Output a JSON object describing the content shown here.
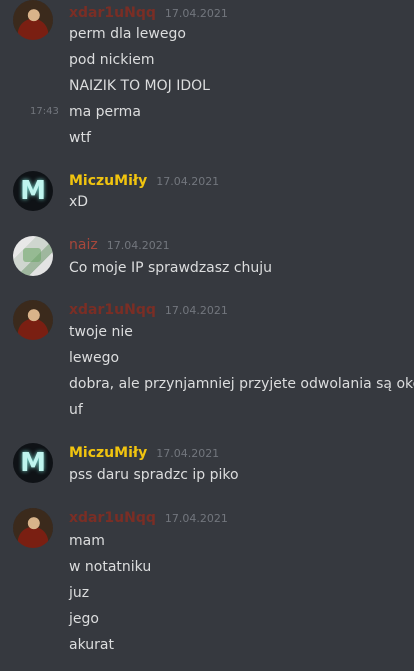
{
  "colors": {
    "user_red": "#7a2e25",
    "user_yellow": "#f1c40f",
    "user_brown": "#a8473b"
  },
  "groups": [
    {
      "username": "xdar1uNqq",
      "date": "17.04.2021",
      "lines": [
        "perm dla lewego",
        "pod nickiem",
        "NAIZIK TO MOJ IDOL",
        "ma perma",
        "wtf"
      ],
      "hover_time": "17:43"
    },
    {
      "username": "MiczuMiły",
      "date": "17.04.2021",
      "lines": [
        "xD"
      ]
    },
    {
      "username": "naiz",
      "date": "17.04.2021",
      "lines": [
        "Co moje IP sprawdzasz chuju"
      ]
    },
    {
      "username": "xdar1uNqq",
      "date": "17.04.2021",
      "lines": [
        "twoje nie",
        "lewego",
        "dobra, ale przynjamniej przyjete odwolania są okej",
        "uf"
      ]
    },
    {
      "username": "MiczuMiły",
      "date": "17.04.2021",
      "lines": [
        "pss daru spradzc ip piko"
      ]
    },
    {
      "username": "xdar1uNqq",
      "date": "17.04.2021",
      "lines": [
        "mam",
        "w notatniku",
        "juz",
        "jego",
        "akurat"
      ]
    }
  ]
}
